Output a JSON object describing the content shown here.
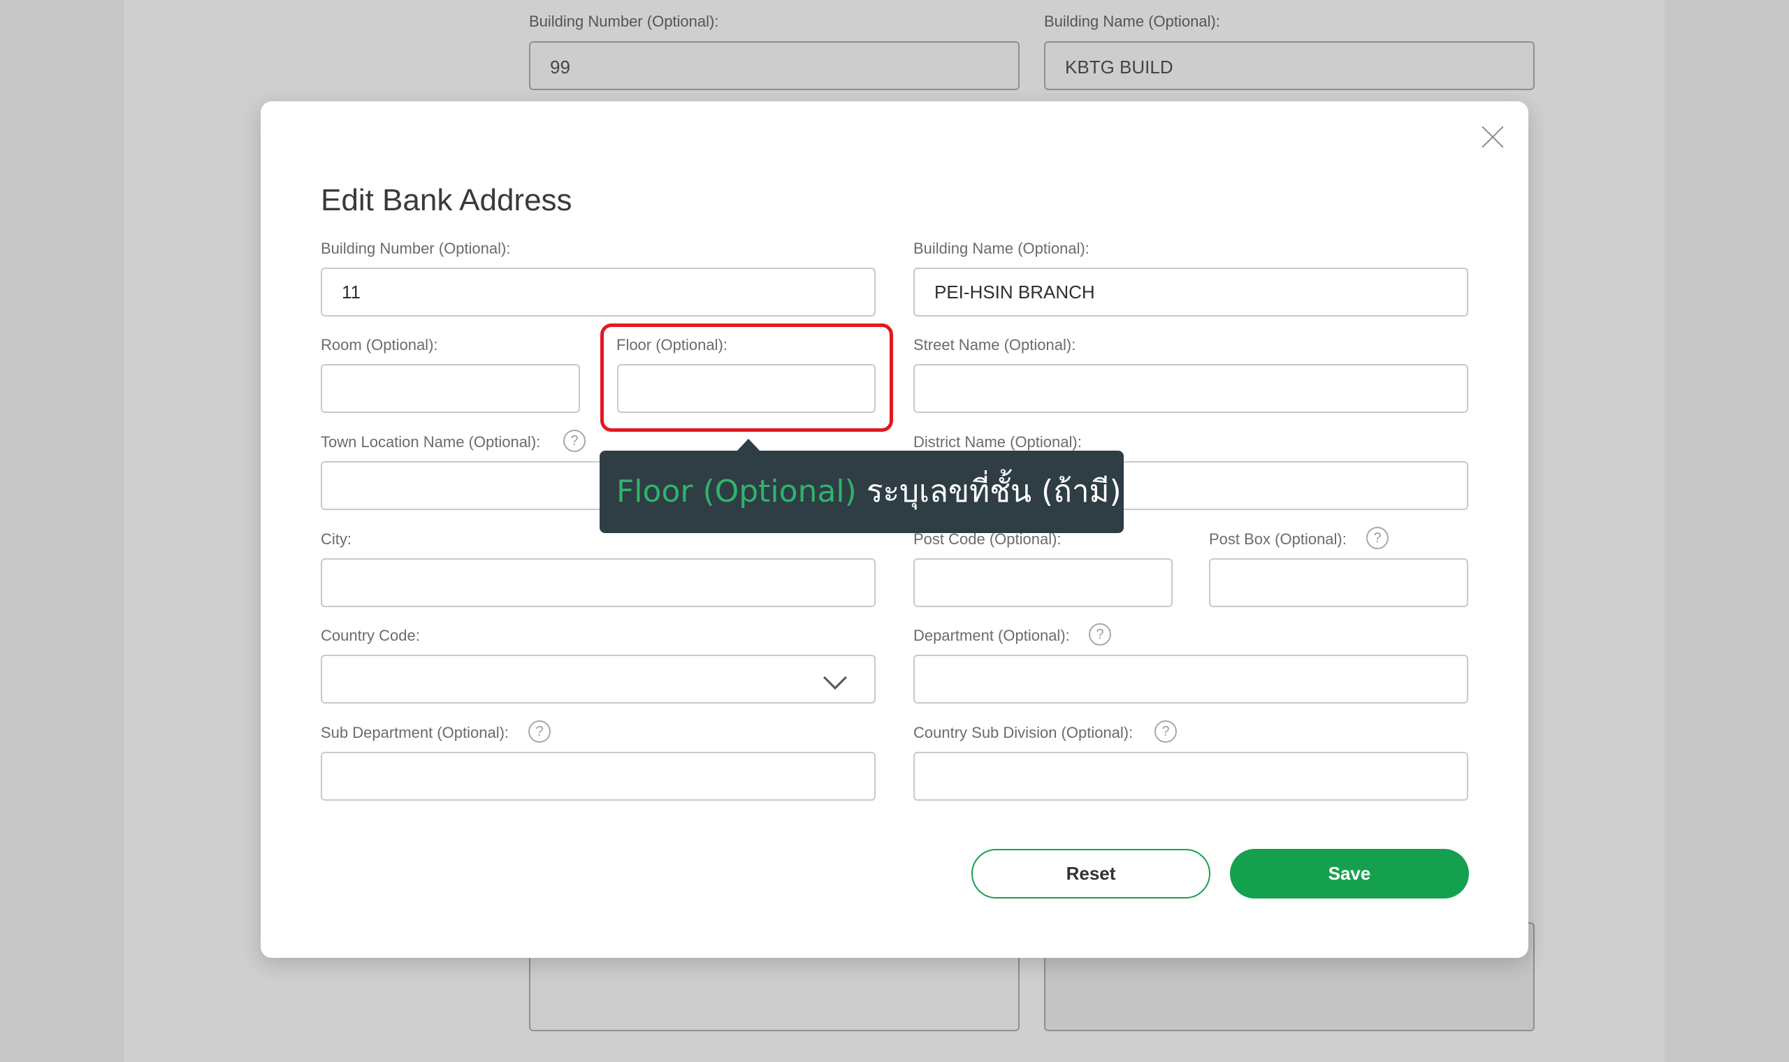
{
  "background": {
    "building_number_label": "Building Number (Optional):",
    "building_number_value": "99",
    "building_name_label": "Building Name (Optional):",
    "building_name_value": "KBTG BUILD"
  },
  "modal": {
    "title": "Edit Bank Address",
    "fields": {
      "building_number": {
        "label": "Building Number (Optional):",
        "value": "11"
      },
      "building_name": {
        "label": "Building Name (Optional):",
        "value": "PEI-HSIN BRANCH"
      },
      "room": {
        "label": "Room (Optional):",
        "value": ""
      },
      "floor": {
        "label": "Floor (Optional):",
        "value": ""
      },
      "street_name": {
        "label": "Street Name (Optional):",
        "value": ""
      },
      "town_location_name": {
        "label": "Town Location Name (Optional):",
        "value": ""
      },
      "district_name": {
        "label": "District Name (Optional):",
        "value": ""
      },
      "city": {
        "label": "City:",
        "value": ""
      },
      "post_code": {
        "label": "Post Code (Optional):",
        "value": ""
      },
      "post_box": {
        "label": "Post Box (Optional):",
        "value": ""
      },
      "country_code": {
        "label": "Country Code:",
        "value": ""
      },
      "department": {
        "label": "Department (Optional):",
        "value": ""
      },
      "sub_department": {
        "label": "Sub Department (Optional):",
        "value": ""
      },
      "country_sub_division": {
        "label": "Country Sub Division (Optional):",
        "value": ""
      }
    },
    "help_glyph": "?",
    "buttons": {
      "reset": "Reset",
      "save": "Save"
    }
  },
  "tooltip": {
    "field_name": "Floor (Optional)",
    "description": " ระบุเลขที่ชั้น (ถ้ามี)"
  },
  "colors": {
    "accent_green": "#15a04f",
    "highlight_red": "#e3181e",
    "tooltip_bg": "#2f3d45"
  }
}
